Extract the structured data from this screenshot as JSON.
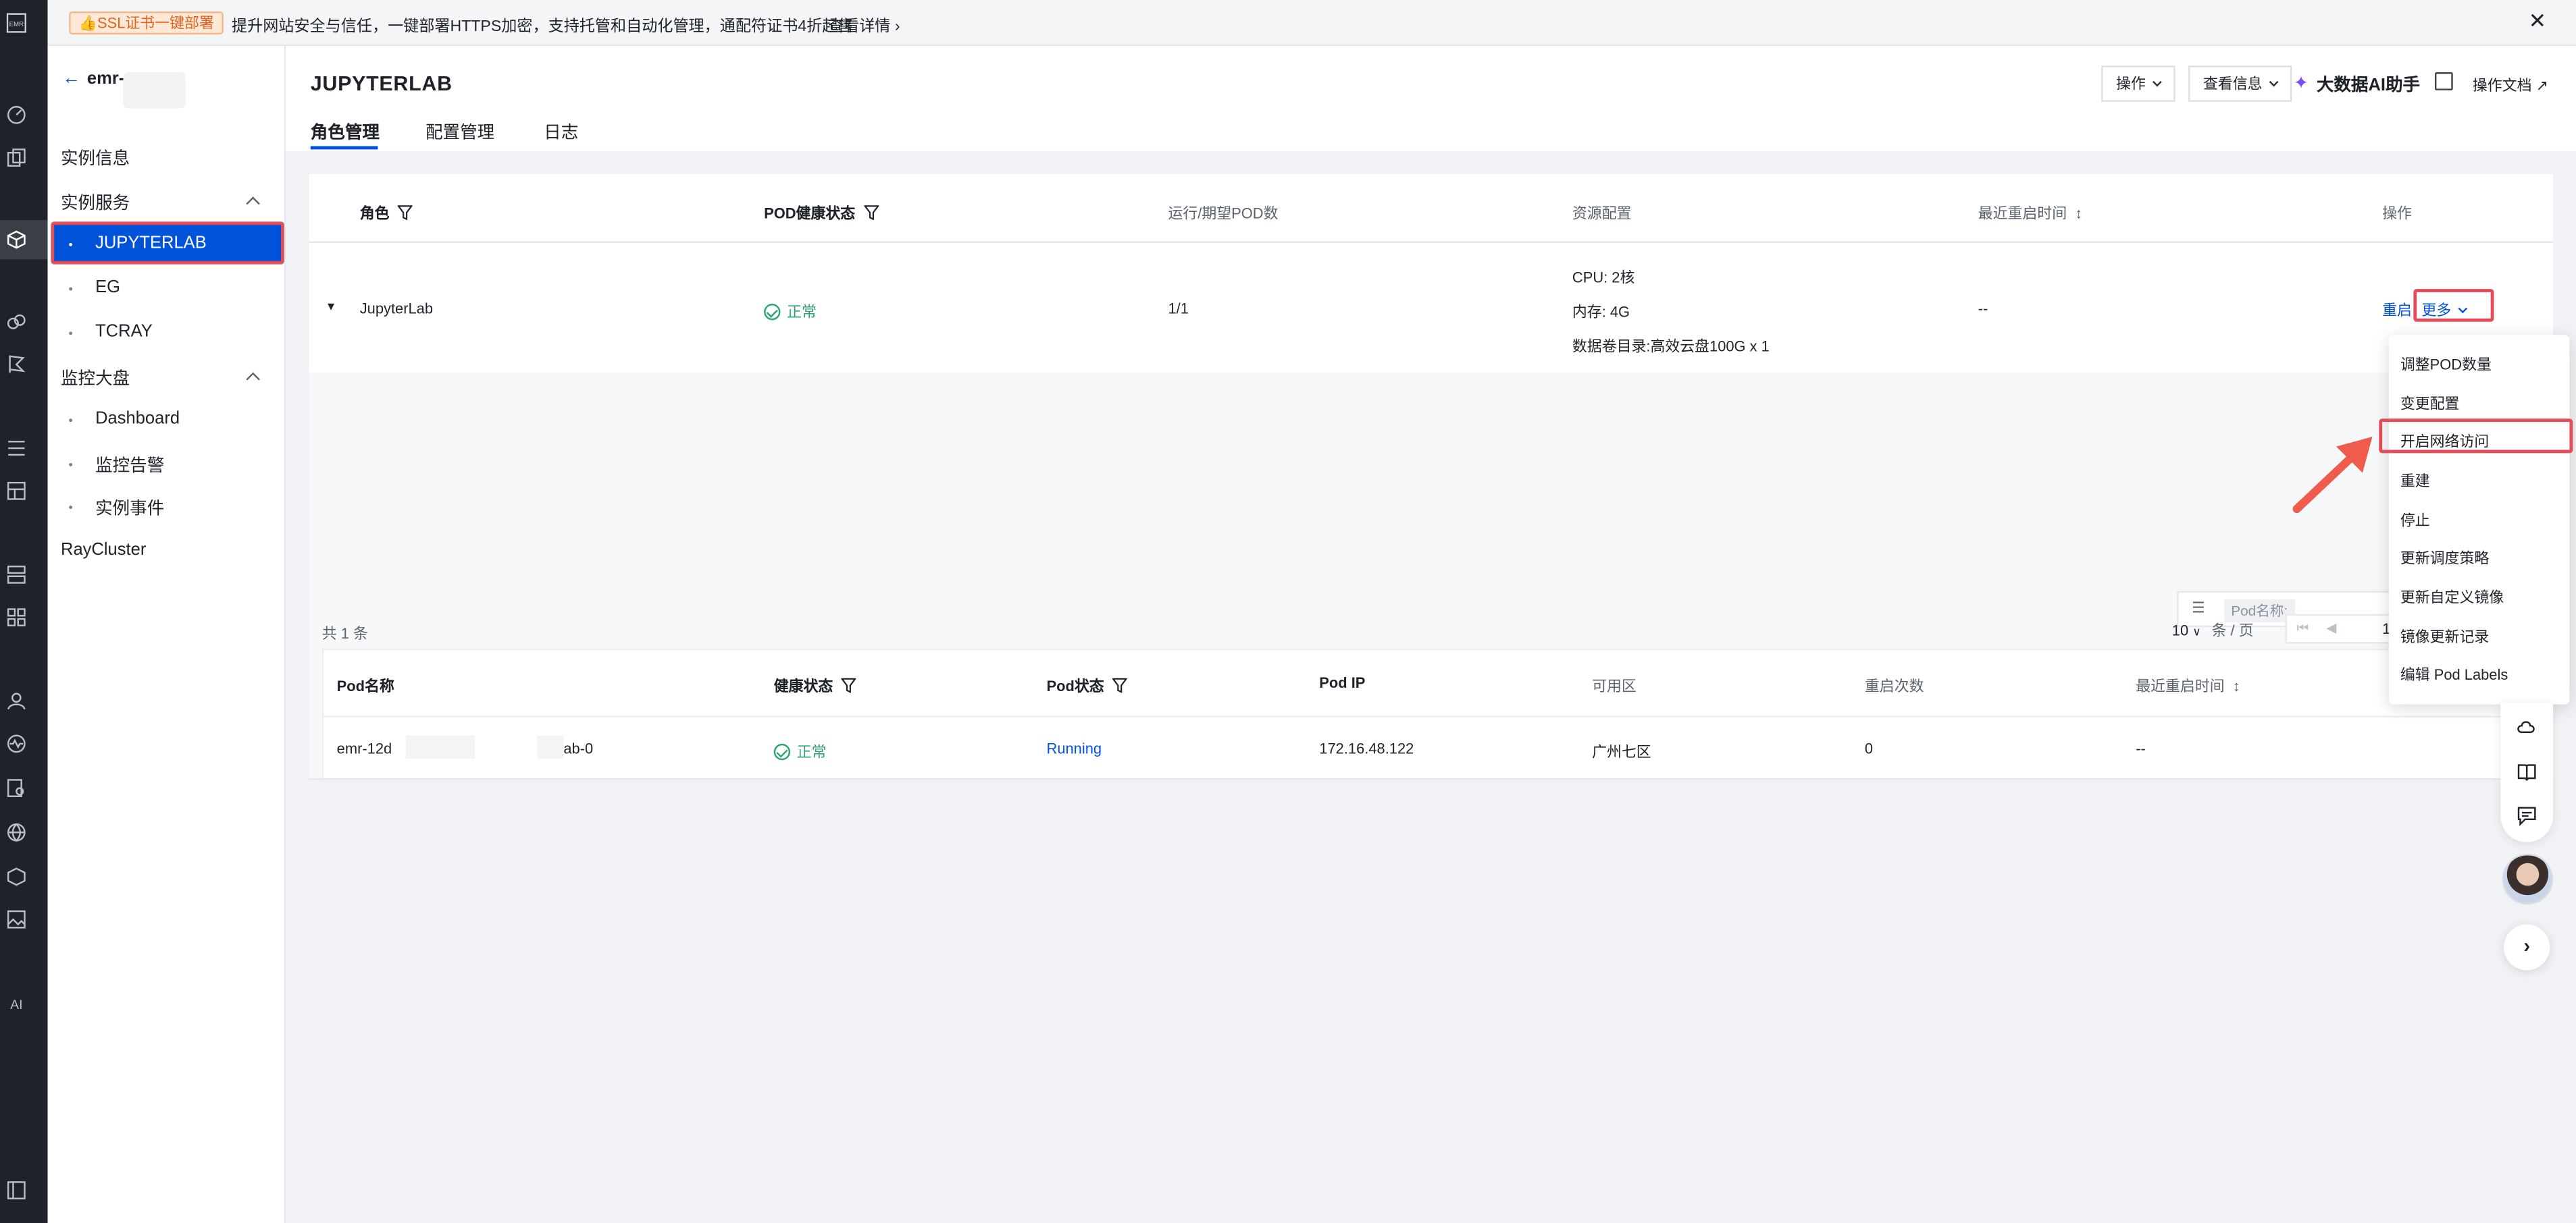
{
  "banner": {
    "badge": "👍SSL证书一键部署",
    "text": "提升网站安全与信任，一键部署HTTPS加密，支持托管和自动化管理，通配符证书4折起售",
    "link": "查看详情 ›",
    "close": "✕"
  },
  "sidebar": {
    "instance_name": "emr-",
    "items": {
      "instance_info": "实例信息",
      "instance_service": "实例服务",
      "jupyterlab": "JUPYTERLAB",
      "eg": "EG",
      "tcray": "TCRAY",
      "monitor": "监控大盘",
      "dashboard": "Dashboard",
      "alarm": "监控告警",
      "events": "实例事件",
      "raycluster": "RayCluster"
    }
  },
  "header": {
    "title": "JUPYTERLAB",
    "ops_button": "操作",
    "view_info_button": "查看信息",
    "ai_helper": "大数据AI助手",
    "doc_link": "操作文档 ↗",
    "tabs": [
      "角色管理",
      "配置管理",
      "日志"
    ]
  },
  "role_table": {
    "headers": {
      "role": "角色",
      "pod_health": "POD健康状态",
      "running": "运行/期望POD数",
      "resource": "资源配置",
      "last_restart": "最近重启时间",
      "ops": "操作"
    },
    "row": {
      "role": "JupyterLab",
      "health": "正常",
      "running": "1/1",
      "cpu": "CPU: 2核",
      "mem": "内存: 4G",
      "disk": "数据卷目录:高效云盘100G x 1",
      "last_restart": "--",
      "restart": "重启",
      "more": "更多"
    }
  },
  "pod_search": {
    "label": "Pod名称:"
  },
  "pod_table": {
    "headers": {
      "name": "Pod名称",
      "health": "健康状态",
      "status": "Pod状态",
      "ip": "Pod IP",
      "zone": "可用区",
      "restarts": "重启次数",
      "last_restart": "最近重启时间"
    },
    "row": {
      "name_prefix": "emr-12d",
      "name_suffix": "ab-0",
      "health": "正常",
      "status": "Running",
      "ip": "172.16.48.122",
      "zone": "广州七区",
      "restarts": "0",
      "last_restart": "--"
    }
  },
  "pagination": {
    "total": "共 1 条",
    "page_size": "10",
    "per_page": "条 / 页",
    "current_page": "1"
  },
  "more_menu": [
    "调整POD数量",
    "变更配置",
    "开启网络访问",
    "重建",
    "停止",
    "更新调度策略",
    "更新自定义镜像",
    "镜像更新记录",
    "编辑 Pod Labels"
  ],
  "colors": {
    "brand": "#0052d9",
    "success": "#2ba471",
    "highlight": "#e34d59"
  }
}
